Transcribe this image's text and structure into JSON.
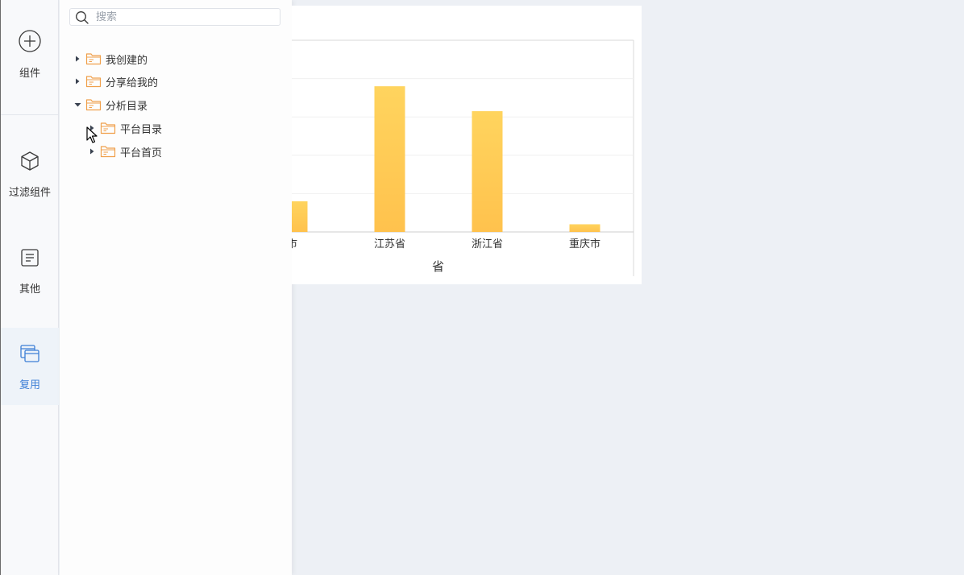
{
  "rail": {
    "items": [
      {
        "label": "组件",
        "icon": "plus-circle-icon"
      },
      {
        "label": "过滤组件",
        "icon": "cube-icon"
      },
      {
        "label": "其他",
        "icon": "document-icon"
      },
      {
        "label": "复用",
        "icon": "reuse-windows-icon",
        "active": true
      }
    ],
    "active_color": "#3d7fd6"
  },
  "search": {
    "placeholder": "搜索",
    "value": ""
  },
  "tree": [
    {
      "label": "我创建的",
      "expanded": false,
      "level": 0
    },
    {
      "label": "分享给我的",
      "expanded": false,
      "level": 0
    },
    {
      "label": "分析目录",
      "expanded": true,
      "level": 0
    },
    {
      "label": "平台目录",
      "expanded": false,
      "level": 1
    },
    {
      "label": "平台首页",
      "expanded": false,
      "level": 1
    }
  ],
  "folder_color": "#f0a04b",
  "chart_data": {
    "type": "bar",
    "categories": [
      "市",
      "江苏省",
      "浙江省",
      "重庆市"
    ],
    "values": [
      8,
      38,
      31.5,
      2
    ],
    "xlabel": "省",
    "ylim": [
      0,
      50
    ],
    "grid": true,
    "bar_color": "#ffc857"
  }
}
